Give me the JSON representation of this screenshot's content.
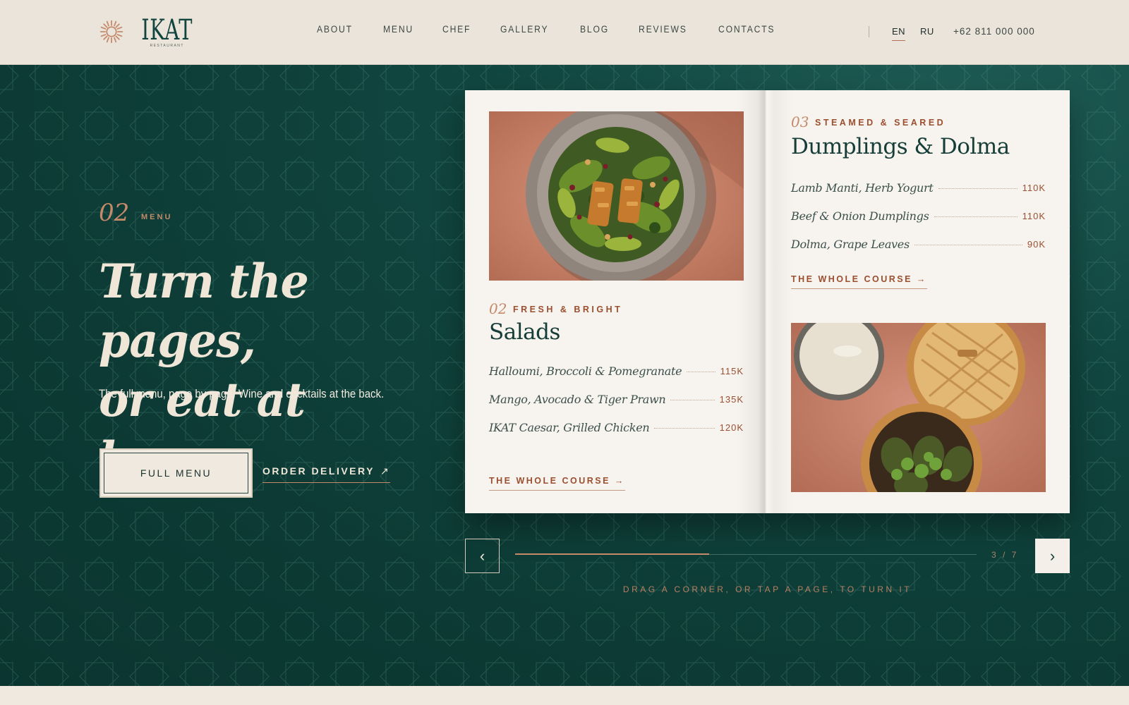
{
  "brand": {
    "name": "IKAT",
    "tagline": "RESTAURANT",
    "accent": "#c48a6a",
    "dark_green": "#0d3a34"
  },
  "nav": {
    "items": [
      "ABOUT",
      "MENU",
      "CHEF",
      "GALLERY",
      "BLOG",
      "REVIEWS",
      "CONTACTS"
    ]
  },
  "header": {
    "lang_active": "EN",
    "lang_other": "RU",
    "phone": "+62 811 000 000"
  },
  "hero": {
    "section_number": "02",
    "section_label": "MENU",
    "title_line1": "Turn the pages,",
    "title_line2": "or eat at home",
    "subtitle": "The full menu, page by page. Wine and cocktails at the back.",
    "primary_button": "FULL MENU",
    "secondary_link": "ORDER DELIVERY",
    "secondary_arrow": "↗"
  },
  "book": {
    "left_page": {
      "image": "salad-bowl-photo",
      "number": "02",
      "subtitle": "FRESH & BRIGHT",
      "title": "Salads",
      "items": [
        {
          "name": "Halloumi, Broccoli & Pomegranate",
          "price": "115K"
        },
        {
          "name": "Mango, Avocado & Tiger Prawn",
          "price": "135K"
        },
        {
          "name": "IKAT Caesar, Grilled Chicken",
          "price": "120K"
        }
      ],
      "link": "THE WHOLE COURSE →"
    },
    "right_page": {
      "image": "dumplings-steamer-photo",
      "number": "03",
      "subtitle": "STEAMED & SEARED",
      "title": "Dumplings & Dolma",
      "items": [
        {
          "name": "Lamb Manti, Herb Yogurt",
          "price": "110K"
        },
        {
          "name": "Beef & Onion Dumplings",
          "price": "110K"
        },
        {
          "name": "Dolma, Grape Leaves",
          "price": "90K"
        }
      ],
      "link": "THE WHOLE COURSE →"
    }
  },
  "pager": {
    "prev": "‹",
    "next": "›",
    "count": "3 / 7",
    "progress": 0.42
  },
  "hint": "DRAG A CORNER, OR TAP A PAGE, TO TURN IT"
}
